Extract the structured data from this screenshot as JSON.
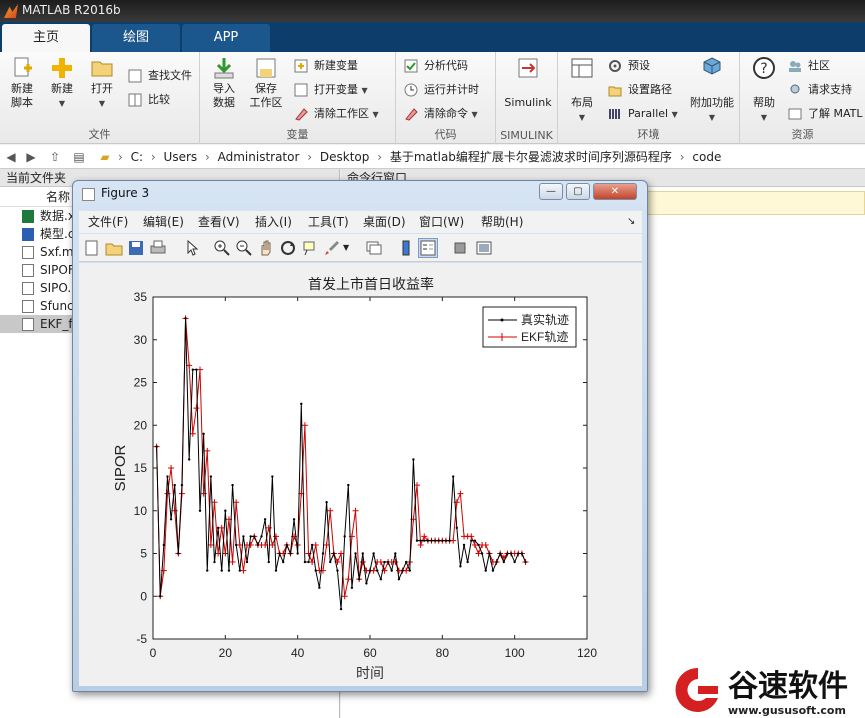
{
  "window": {
    "title": "MATLAB R2016b"
  },
  "tabs": [
    {
      "label": "主页",
      "active": true
    },
    {
      "label": "绘图",
      "active": false
    },
    {
      "label": "APP",
      "active": false
    }
  ],
  "ribbon": {
    "file": {
      "title": "文件",
      "new_script": "新建\n脚本",
      "new": "新建",
      "open": "打开",
      "find_files": "查找文件",
      "compare": "比较"
    },
    "variable": {
      "title": "变量",
      "import": "导入\n数据",
      "save_ws": "保存\n工作区",
      "new_var": "新建变量",
      "open_var": "打开变量",
      "clear_ws": "清除工作区"
    },
    "code": {
      "title": "代码",
      "analyze": "分析代码",
      "run_time": "运行并计时",
      "clear_cmd": "清除命令"
    },
    "simulink": {
      "title": "SIMULINK",
      "simulink": "Simulink"
    },
    "env": {
      "title": "环境",
      "layout": "布局",
      "prefs": "预设",
      "set_path": "设置路径",
      "parallel": "Parallel",
      "addons": "附加功能"
    },
    "resources": {
      "title": "资源",
      "help": "帮助",
      "community": "社区",
      "support": "请求支持",
      "learn": "了解 MATL"
    }
  },
  "address": {
    "crumbs": [
      "C:",
      "Users",
      "Administrator",
      "Desktop",
      "基于matlab编程扩展卡尔曼滤波求时间序列源码程序",
      "code"
    ]
  },
  "left_panel": {
    "title": "当前文件夹",
    "col_name": "名称",
    "files": [
      {
        "name": "数据.x",
        "selected": false
      },
      {
        "name": "模型.c",
        "selected": false
      },
      {
        "name": "Sxf.m",
        "selected": false
      },
      {
        "name": "SIPOF",
        "selected": false
      },
      {
        "name": "SIPO.",
        "selected": false
      },
      {
        "name": "Sfunc",
        "selected": false
      },
      {
        "name": "EKF_f",
        "selected": true
      }
    ]
  },
  "right_panel": {
    "title": "命令行窗口"
  },
  "figure": {
    "title": "Figure 3",
    "menu": [
      "文件(F)",
      "编辑(E)",
      "查看(V)",
      "插入(I)",
      "工具(T)",
      "桌面(D)",
      "窗口(W)",
      "帮助(H)"
    ]
  },
  "chart_data": {
    "type": "line",
    "title": "首发上市首日收益率",
    "xlabel": "时间",
    "ylabel": "SIPOR",
    "xlim": [
      0,
      120
    ],
    "ylim": [
      -5,
      35
    ],
    "xticks": [
      0,
      20,
      40,
      60,
      80,
      100,
      120
    ],
    "yticks": [
      -5,
      0,
      5,
      10,
      15,
      20,
      25,
      30,
      35
    ],
    "legend_position": "top-right",
    "series": [
      {
        "name": "真实轨迹",
        "color": "#000000",
        "marker": ".",
        "values": [
          17.5,
          0,
          6,
          14,
          9,
          13,
          5,
          13,
          32.5,
          16,
          26.5,
          26.5,
          10,
          19,
          3,
          14,
          4,
          8,
          3,
          10,
          3,
          13,
          6,
          3,
          7,
          4,
          7,
          7,
          6,
          7,
          9,
          4,
          14,
          3,
          5,
          4,
          6,
          5,
          9,
          5,
          22.5,
          4,
          4,
          6,
          3,
          1,
          5,
          11,
          4,
          5,
          3,
          -1.5,
          7,
          13,
          1,
          5,
          2,
          5,
          1.5,
          3,
          5,
          3,
          2,
          4,
          4,
          3,
          5,
          2,
          3,
          4,
          3,
          16,
          6.5,
          6.5,
          6.5,
          6.5,
          6.5,
          6.5,
          6.5,
          6.5,
          6.5,
          6.5,
          14,
          8,
          3.5,
          6,
          4,
          6.5,
          6.5,
          6,
          5,
          3,
          5,
          3,
          4,
          5,
          4,
          5,
          5,
          4,
          5,
          5,
          4
        ]
      },
      {
        "name": "EKF轨迹",
        "color": "#d40000",
        "marker": "+",
        "values": [
          17.5,
          0,
          3,
          12,
          15,
          10,
          5,
          12,
          32.5,
          27,
          19,
          22,
          26.5,
          12,
          17,
          6,
          11,
          5,
          8,
          5,
          9,
          4,
          11,
          6,
          3,
          6,
          6,
          7,
          6,
          6,
          6,
          8,
          6,
          7,
          5,
          5,
          6,
          5,
          7,
          6,
          12,
          20,
          5,
          4,
          6,
          3,
          3,
          6,
          10,
          5,
          4,
          5,
          0,
          2,
          7,
          10,
          2,
          4,
          3,
          3,
          3,
          4,
          4,
          3,
          4,
          4,
          4,
          3,
          3,
          3,
          4,
          9,
          13,
          6,
          7,
          6.5,
          6.5,
          6.5,
          6.5,
          6.5,
          6.5,
          6.5,
          6.5,
          11,
          12,
          7,
          7,
          7,
          6,
          5,
          6,
          6,
          5,
          4,
          4,
          5,
          4.5,
          5,
          5,
          5,
          5,
          5,
          4
        ]
      }
    ]
  },
  "watermark": {
    "text": "谷速软件",
    "url": "www.gususoft.com"
  }
}
